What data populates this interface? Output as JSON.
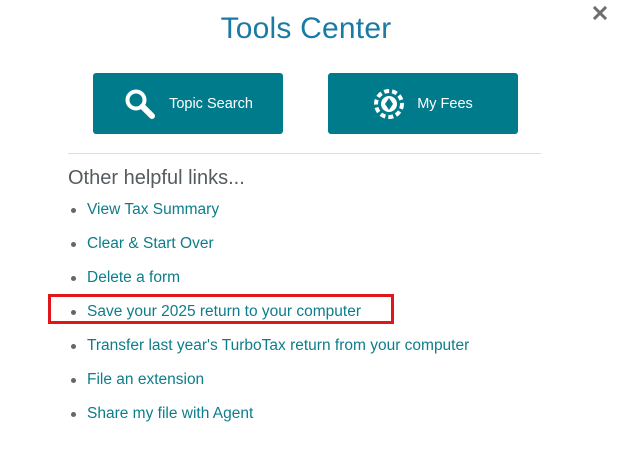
{
  "dialog": {
    "title": "Tools Center",
    "close_icon": "close-icon"
  },
  "buttons": [
    {
      "label": "Topic Search",
      "icon": "magnifier-icon"
    },
    {
      "label": "My Fees",
      "icon": "fees-icon"
    }
  ],
  "links_section": {
    "heading": "Other helpful links...",
    "items": [
      {
        "label": "View Tax Summary"
      },
      {
        "label": "Clear & Start Over"
      },
      {
        "label": "Delete a form"
      },
      {
        "label": "Save your 2025 return to your computer",
        "highlighted": true
      },
      {
        "label": "Transfer last year's TurboTax return from your computer"
      },
      {
        "label": "File an extension"
      },
      {
        "label": "Share my file with Agent"
      }
    ]
  },
  "colors": {
    "title": "#1a7aa6",
    "button_bg": "#007b8c",
    "link": "#0d7d8a",
    "heading": "#555b5e",
    "highlight_border": "#e0161b"
  }
}
